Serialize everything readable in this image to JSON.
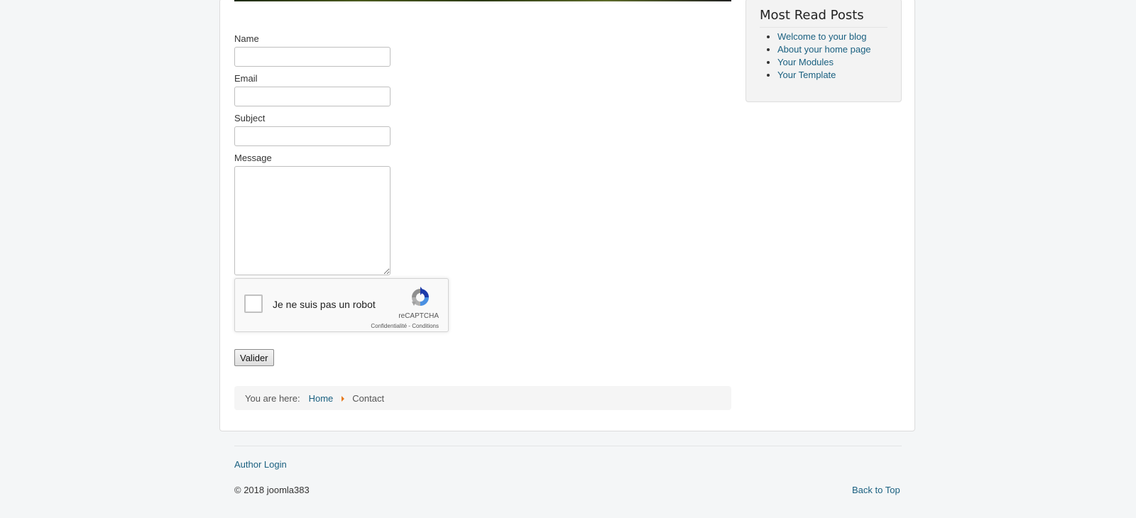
{
  "contact_form": {
    "fields": {
      "name_label": "Name",
      "email_label": "Email",
      "subject_label": "Subject",
      "message_label": "Message"
    },
    "recaptcha": {
      "checkbox_label": "Je ne suis pas un robot",
      "brand": "reCAPTCHA",
      "privacy_link": "Confidentialité",
      "separator": " - ",
      "terms_link": "Conditions"
    },
    "submit_label": "Valider"
  },
  "breadcrumb": {
    "prefix": "You are here:",
    "items": [
      "Home",
      "Contact"
    ]
  },
  "sidebar": {
    "title": "Most Read Posts",
    "links": [
      "Welcome to your blog",
      "About your home page",
      "Your Modules",
      "Your Template"
    ]
  },
  "footer": {
    "author_login": "Author Login",
    "copyright": "© 2018 joomla383",
    "back_to_top": "Back to Top"
  },
  "colors": {
    "link": "#1a6080",
    "breadcrumb_separator": "#e8791e",
    "page_background": "#f4f6f7"
  }
}
